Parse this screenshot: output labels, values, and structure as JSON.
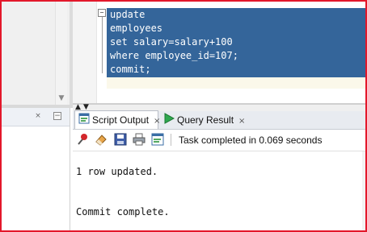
{
  "editor": {
    "lines": [
      "update",
      "employees",
      "set salary=salary+100",
      "where employee_id=107;",
      "commit;"
    ],
    "fold_marker": "−",
    "selection_color": "#34659a",
    "current_line_color": "#fbf8ea"
  },
  "output_tabs": [
    {
      "label": "Script Output",
      "icon": "script-output-icon",
      "close": "×"
    },
    {
      "label": "Query Result",
      "icon": "run-arrow-icon",
      "close": "×"
    }
  ],
  "toolbar": {
    "icons": [
      "pin-icon",
      "eraser-icon",
      "save-icon",
      "print-icon",
      "export-icon"
    ],
    "status": "Task completed in 0.069 seconds"
  },
  "output": {
    "lines": [
      "1 row updated.",
      "Commit complete."
    ]
  },
  "colors": {
    "frame_border": "#e3182b"
  }
}
